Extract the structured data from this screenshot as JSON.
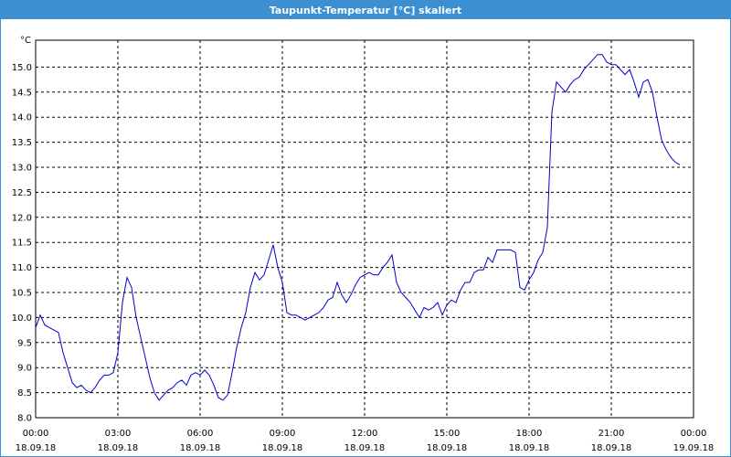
{
  "window": {
    "title": "Taupunkt-Temperatur [°C] skaliert"
  },
  "chart_data": {
    "type": "line",
    "title": "Taupunkt-Temperatur [°C] skaliert",
    "ylabel": "°C",
    "xlabel": "",
    "ylim": [
      8.0,
      15.5
    ],
    "xlim": [
      "2018-09-18 00:00",
      "2018-09-19 00:00"
    ],
    "grid": true,
    "line_color": "#0000cc",
    "y_ticks": [
      "8.0",
      "8.5",
      "9.0",
      "9.5",
      "10.0",
      "10.5",
      "11.0",
      "11.5",
      "12.0",
      "12.5",
      "13.0",
      "13.5",
      "14.0",
      "14.5",
      "15.0"
    ],
    "x_ticks": [
      {
        "time": "00:00",
        "date": "18.09.18"
      },
      {
        "time": "03:00",
        "date": "18.09.18"
      },
      {
        "time": "06:00",
        "date": "18.09.18"
      },
      {
        "time": "09:00",
        "date": "18.09.18"
      },
      {
        "time": "12:00",
        "date": "18.09.18"
      },
      {
        "time": "15:00",
        "date": "18.09.18"
      },
      {
        "time": "18:00",
        "date": "18.09.18"
      },
      {
        "time": "21:00",
        "date": "18.09.18"
      },
      {
        "time": "00:00",
        "date": "19.09.18"
      }
    ],
    "series": [
      {
        "points": [
          [
            "00:00",
            9.8
          ],
          [
            "00:10",
            10.05
          ],
          [
            "00:20",
            9.85
          ],
          [
            "00:30",
            9.8
          ],
          [
            "00:40",
            9.75
          ],
          [
            "00:50",
            9.7
          ],
          [
            "01:00",
            9.3
          ],
          [
            "01:10",
            9.0
          ],
          [
            "01:20",
            8.7
          ],
          [
            "01:30",
            8.6
          ],
          [
            "01:40",
            8.65
          ],
          [
            "01:50",
            8.55
          ],
          [
            "02:00",
            8.5
          ],
          [
            "02:10",
            8.6
          ],
          [
            "02:20",
            8.75
          ],
          [
            "02:30",
            8.85
          ],
          [
            "02:40",
            8.85
          ],
          [
            "02:50",
            8.9
          ],
          [
            "03:00",
            9.3
          ],
          [
            "03:10",
            10.3
          ],
          [
            "03:20",
            10.8
          ],
          [
            "03:30",
            10.6
          ],
          [
            "03:40",
            10.0
          ],
          [
            "03:50",
            9.6
          ],
          [
            "04:00",
            9.2
          ],
          [
            "04:10",
            8.8
          ],
          [
            "04:20",
            8.5
          ],
          [
            "04:30",
            8.35
          ],
          [
            "04:40",
            8.45
          ],
          [
            "04:50",
            8.55
          ],
          [
            "05:00",
            8.6
          ],
          [
            "05:10",
            8.7
          ],
          [
            "05:20",
            8.75
          ],
          [
            "05:30",
            8.65
          ],
          [
            "05:40",
            8.85
          ],
          [
            "05:50",
            8.9
          ],
          [
            "06:00",
            8.85
          ],
          [
            "06:10",
            8.95
          ],
          [
            "06:20",
            8.85
          ],
          [
            "06:30",
            8.65
          ],
          [
            "06:40",
            8.4
          ],
          [
            "06:50",
            8.35
          ],
          [
            "07:00",
            8.45
          ],
          [
            "07:10",
            8.9
          ],
          [
            "07:20",
            9.4
          ],
          [
            "07:30",
            9.8
          ],
          [
            "07:40",
            10.1
          ],
          [
            "07:50",
            10.6
          ],
          [
            "08:00",
            10.9
          ],
          [
            "08:10",
            10.75
          ],
          [
            "08:20",
            10.85
          ],
          [
            "08:30",
            11.15
          ],
          [
            "08:40",
            11.45
          ],
          [
            "08:50",
            11.0
          ],
          [
            "09:00",
            10.7
          ],
          [
            "09:10",
            10.1
          ],
          [
            "09:20",
            10.05
          ],
          [
            "09:30",
            10.05
          ],
          [
            "09:40",
            10.0
          ],
          [
            "09:50",
            9.95
          ],
          [
            "10:00",
            10.0
          ],
          [
            "10:10",
            10.05
          ],
          [
            "10:20",
            10.1
          ],
          [
            "10:30",
            10.2
          ],
          [
            "10:40",
            10.35
          ],
          [
            "10:50",
            10.4
          ],
          [
            "11:00",
            10.7
          ],
          [
            "11:10",
            10.45
          ],
          [
            "11:20",
            10.3
          ],
          [
            "11:30",
            10.45
          ],
          [
            "11:40",
            10.65
          ],
          [
            "11:50",
            10.8
          ],
          [
            "12:00",
            10.85
          ],
          [
            "12:10",
            10.9
          ],
          [
            "12:20",
            10.85
          ],
          [
            "12:30",
            10.85
          ],
          [
            "12:40",
            11.0
          ],
          [
            "12:50",
            11.1
          ],
          [
            "13:00",
            11.25
          ],
          [
            "13:10",
            10.7
          ],
          [
            "13:20",
            10.5
          ],
          [
            "13:30",
            10.4
          ],
          [
            "13:40",
            10.3
          ],
          [
            "13:50",
            10.15
          ],
          [
            "14:00",
            10.0
          ],
          [
            "14:10",
            10.2
          ],
          [
            "14:20",
            10.15
          ],
          [
            "14:30",
            10.2
          ],
          [
            "14:40",
            10.3
          ],
          [
            "14:50",
            10.05
          ],
          [
            "15:00",
            10.25
          ],
          [
            "15:10",
            10.35
          ],
          [
            "15:20",
            10.3
          ],
          [
            "15:30",
            10.55
          ],
          [
            "15:40",
            10.7
          ],
          [
            "15:50",
            10.7
          ],
          [
            "16:00",
            10.9
          ],
          [
            "16:10",
            10.95
          ],
          [
            "16:20",
            10.95
          ],
          [
            "16:30",
            11.2
          ],
          [
            "16:40",
            11.1
          ],
          [
            "16:50",
            11.35
          ],
          [
            "17:00",
            11.35
          ],
          [
            "17:10",
            11.35
          ],
          [
            "17:20",
            11.35
          ],
          [
            "17:30",
            11.3
          ],
          [
            "17:40",
            10.6
          ],
          [
            "17:50",
            10.55
          ],
          [
            "18:00",
            10.75
          ],
          [
            "18:10",
            10.9
          ],
          [
            "18:20",
            11.15
          ],
          [
            "18:30",
            11.3
          ],
          [
            "18:40",
            11.8
          ],
          [
            "18:50",
            14.1
          ],
          [
            "19:00",
            14.7
          ],
          [
            "19:10",
            14.6
          ],
          [
            "19:20",
            14.5
          ],
          [
            "19:30",
            14.65
          ],
          [
            "19:40",
            14.75
          ],
          [
            "19:50",
            14.8
          ],
          [
            "20:00",
            14.95
          ],
          [
            "20:10",
            15.05
          ],
          [
            "20:20",
            15.15
          ],
          [
            "20:30",
            15.25
          ],
          [
            "20:40",
            15.25
          ],
          [
            "20:50",
            15.1
          ],
          [
            "21:00",
            15.05
          ],
          [
            "21:10",
            15.05
          ],
          [
            "21:20",
            14.95
          ],
          [
            "21:30",
            14.85
          ],
          [
            "21:40",
            14.95
          ],
          [
            "21:50",
            14.7
          ],
          [
            "22:00",
            14.4
          ],
          [
            "22:10",
            14.7
          ],
          [
            "22:20",
            14.75
          ],
          [
            "22:30",
            14.5
          ],
          [
            "22:40",
            14.0
          ],
          [
            "22:50",
            13.55
          ],
          [
            "23:00",
            13.35
          ],
          [
            "23:10",
            13.2
          ],
          [
            "23:20",
            13.1
          ],
          [
            "23:30",
            13.05
          ]
        ]
      }
    ]
  }
}
